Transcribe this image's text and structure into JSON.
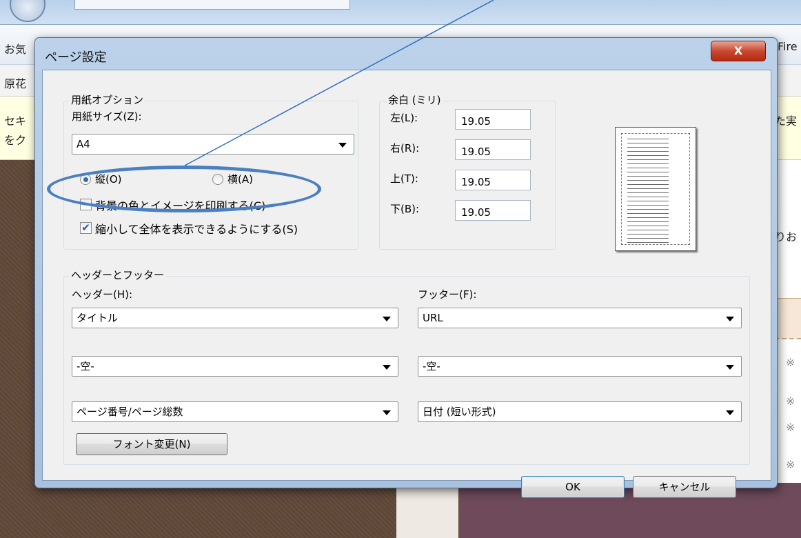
{
  "background": {
    "left_texts": [
      "お気",
      "原花",
      "セキ",
      "をク"
    ],
    "right_texts": [
      "Fire",
      "た実",
      "りお",
      "※",
      "※",
      "※",
      "※"
    ]
  },
  "dialog": {
    "title": "ページ設定",
    "close_label": "X",
    "paper": {
      "legend": "用紙オプション",
      "size_label": "用紙サイズ(Z):",
      "size_value": "A4",
      "portrait_label": "縦(O)",
      "landscape_label": "横(A)",
      "orientation_selected": "portrait",
      "print_background_label": "背景の色とイメージを印刷する(C)",
      "print_background_checked": false,
      "shrink_to_fit_label": "縮小して全体を表示できるようにする(S)",
      "shrink_to_fit_checked": true
    },
    "margins": {
      "legend": "余白 (ミリ)",
      "left_label": "左(L):",
      "left_value": "19.05",
      "right_label": "右(R):",
      "right_value": "19.05",
      "top_label": "上(T):",
      "top_value": "19.05",
      "bottom_label": "下(B):",
      "bottom_value": "19.05"
    },
    "header_footer": {
      "legend": "ヘッダーとフッター",
      "header_label": "ヘッダー(H):",
      "footer_label": "フッター(F):",
      "header_values": [
        "タイトル",
        "-空-",
        "ページ番号/ページ総数"
      ],
      "footer_values": [
        "URL",
        "-空-",
        "日付 (短い形式)"
      ],
      "font_button": "フォント変更(N)"
    },
    "ok_label": "OK",
    "cancel_label": "キャンセル"
  },
  "annotation": {
    "color": "#4a7fc1"
  }
}
